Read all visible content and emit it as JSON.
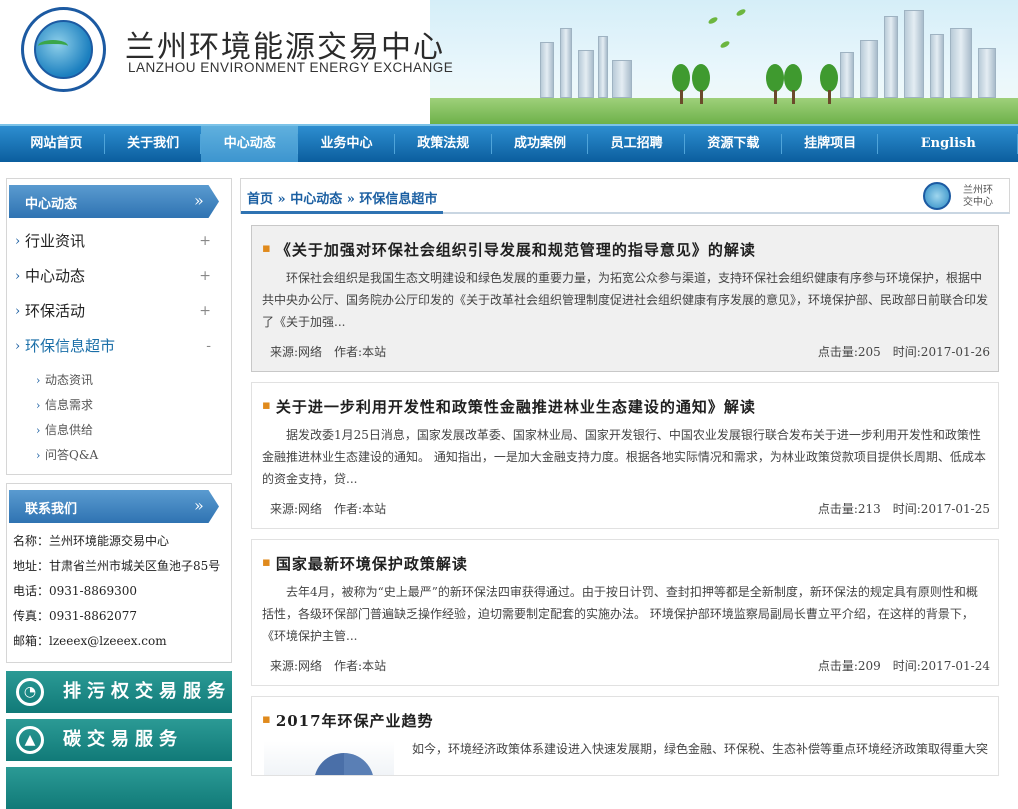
{
  "header": {
    "title": "兰州环境能源交易中心",
    "subtitle": "LANZHOU ENVIRONMENT ENERGY EXCHANGE"
  },
  "nav": [
    {
      "label": "网站首页",
      "active": false
    },
    {
      "label": "关于我们",
      "active": false
    },
    {
      "label": "中心动态",
      "active": true
    },
    {
      "label": "业务中心",
      "active": false
    },
    {
      "label": "政策法规",
      "active": false
    },
    {
      "label": "成功案例",
      "active": false
    },
    {
      "label": "员工招聘",
      "active": false
    },
    {
      "label": "资源下载",
      "active": false
    },
    {
      "label": "挂牌项目",
      "active": false
    },
    {
      "label": "English",
      "active": false
    }
  ],
  "sidebar": {
    "heading": "中心动态",
    "arrow": "»",
    "items": [
      {
        "label": "行业资讯",
        "toggle": "+"
      },
      {
        "label": "中心动态",
        "toggle": "+"
      },
      {
        "label": "环保活动",
        "toggle": "+"
      },
      {
        "label": "环保信息超市",
        "toggle": "-"
      }
    ],
    "subitems": [
      "动态资讯",
      "信息需求",
      "信息供给",
      "问答Q&A"
    ]
  },
  "contact": {
    "heading": "联系我们",
    "lines": [
      "名称：兰州环境能源交易中心",
      "地址：甘肃省兰州市城关区鱼池子85号",
      "电话：0931-8869300",
      "传真：0931-8862077",
      "邮箱：lzeeex@lzeeex.com"
    ]
  },
  "services": [
    "排污权交易服务",
    "碳交易服务"
  ],
  "breadcrumb": {
    "home": "首页",
    "sep": "»",
    "level1": "中心动态",
    "level2": "环保信息超市",
    "logo_text": "兰州环\n交中心"
  },
  "articles": [
    {
      "title": "《关于加强对环保社会组织引导发展和规范管理的指导意见》的解读",
      "summary": "环保社会组织是我国生态文明建设和绿色发展的重要力量，为拓宽公众参与渠道，支持环保社会组织健康有序参与环境保护，根据中共中央办公厅、国务院办公厅印发的《关于改革社会组织管理制度促进社会组织健康有序发展的意见》，环境保护部、民政部日前联合印发了《关于加强...",
      "source": "来源:网络　作者:本站",
      "stats": "点击量:205　时间:2017-01-26"
    },
    {
      "title": "关于进一步利用开发性和政策性金融推进林业生态建设的通知》解读",
      "summary": "据发改委1月25日消息，国家发展改革委、国家林业局、国家开发银行、中国农业发展银行联合发布关于进一步利用开发性和政策性金融推进林业生态建设的通知。 通知指出，一是加大金融支持力度。根据各地实际情况和需求，为林业政策贷款项目提供长周期、低成本的资金支持，贷...",
      "source": "来源:网络　作者:本站",
      "stats": "点击量:213　时间:2017-01-25"
    },
    {
      "title": "国家最新环境保护政策解读",
      "summary": "去年4月，被称为“史上最严”的新环保法四审获得通过。由于按日计罚、查封扣押等都是全新制度，新环保法的规定具有原则性和概括性，各级环保部门普遍缺乏操作经验，迫切需要制定配套的实施办法。 环境保护部环境监察局副局长曹立平介绍，在这样的背景下，《环境保护主管...",
      "source": "来源:网络　作者:本站",
      "stats": "点击量:209　时间:2017-01-24"
    },
    {
      "title": "2017年环保产业趋势",
      "summary": "如今，环境经济政策体系建设进入快速发展期，绿色金融、环保税、生态补偿等重点环境经济政策取得重大突"
    }
  ]
}
